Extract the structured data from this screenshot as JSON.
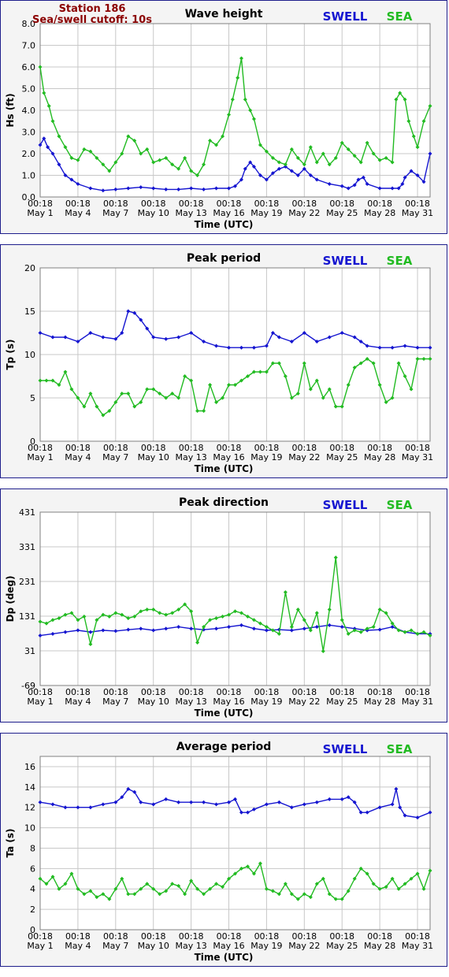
{
  "header": {
    "station": "Station 186",
    "cutoff": "Sea/swell cutoff: 10s"
  },
  "legend": {
    "swell": "SWELL",
    "sea": "SEA"
  },
  "colors": {
    "swell": "#1515d0",
    "sea": "#22bb22",
    "grid": "#c8c8c8",
    "plot_bg": "#ffffff",
    "panel_bg": "#f4f4f4"
  },
  "x_axis": {
    "label": "Time (UTC)",
    "tick_time": "00:18",
    "tick_dates": [
      "May 1",
      "May 4",
      "May 7",
      "May 10",
      "May 13",
      "May 16",
      "May 19",
      "May 22",
      "May 25",
      "May 28",
      "May 31"
    ]
  },
  "chart_data": [
    {
      "type": "line",
      "title": "Wave height",
      "ylabel": "Hs (ft)",
      "xlabel": "Time (UTC)",
      "ylim": [
        0.0,
        8.0
      ],
      "yticks": [
        "0.0",
        "1.0",
        "2.0",
        "3.0",
        "4.0",
        "5.0",
        "6.0",
        "7.0",
        "8.0"
      ],
      "x_unit": "days since May 1 00:18",
      "xlim": [
        0,
        31
      ],
      "grid": true,
      "series": [
        {
          "name": "SWELL",
          "x": [
            0,
            0.3,
            0.6,
            1,
            1.5,
            2,
            2.5,
            3,
            4,
            5,
            6,
            7,
            8,
            9,
            10,
            11,
            12,
            13,
            14,
            15,
            15.5,
            16,
            16.3,
            16.7,
            17,
            17.5,
            18,
            18.5,
            19,
            19.5,
            20,
            20.5,
            21,
            21.5,
            22,
            23,
            24,
            24.5,
            25,
            25.3,
            25.7,
            26,
            27,
            28,
            28.5,
            28.8,
            29,
            29.5,
            30,
            30.5,
            31
          ],
          "values": [
            2.4,
            2.7,
            2.3,
            2.0,
            1.5,
            1.0,
            0.8,
            0.6,
            0.4,
            0.3,
            0.35,
            0.4,
            0.45,
            0.4,
            0.35,
            0.35,
            0.4,
            0.35,
            0.4,
            0.4,
            0.5,
            0.8,
            1.3,
            1.6,
            1.4,
            1.0,
            0.8,
            1.1,
            1.3,
            1.4,
            1.2,
            1.0,
            1.3,
            1.0,
            0.8,
            0.6,
            0.5,
            0.4,
            0.55,
            0.8,
            0.9,
            0.6,
            0.4,
            0.4,
            0.4,
            0.6,
            0.9,
            1.2,
            1.0,
            0.7,
            2.0
          ]
        },
        {
          "name": "SEA",
          "x": [
            0,
            0.3,
            0.7,
            1,
            1.5,
            2,
            2.5,
            3,
            3.5,
            4,
            4.5,
            5,
            5.5,
            6,
            6.5,
            7,
            7.5,
            8,
            8.5,
            9,
            9.5,
            10,
            10.5,
            11,
            11.5,
            12,
            12.5,
            13,
            13.5,
            14,
            14.5,
            15,
            15.3,
            15.7,
            16,
            16.3,
            16.7,
            17,
            17.5,
            18,
            18.5,
            19,
            19.5,
            20,
            20.5,
            21,
            21.5,
            22,
            22.5,
            23,
            23.5,
            24,
            24.5,
            25,
            25.5,
            26,
            26.5,
            27,
            27.5,
            28,
            28.3,
            28.6,
            29,
            29.3,
            29.7,
            30,
            30.5,
            31
          ],
          "values": [
            6.0,
            4.8,
            4.2,
            3.5,
            2.8,
            2.3,
            1.8,
            1.7,
            2.2,
            2.1,
            1.8,
            1.5,
            1.2,
            1.6,
            2.0,
            2.8,
            2.6,
            2.0,
            2.2,
            1.6,
            1.7,
            1.8,
            1.5,
            1.3,
            1.8,
            1.2,
            1.0,
            1.5,
            2.6,
            2.4,
            2.8,
            3.8,
            4.5,
            5.5,
            6.4,
            4.5,
            4.0,
            3.6,
            2.4,
            2.1,
            1.8,
            1.6,
            1.5,
            2.2,
            1.8,
            1.5,
            2.3,
            1.6,
            2.0,
            1.5,
            1.8,
            2.5,
            2.2,
            1.9,
            1.6,
            2.5,
            2.0,
            1.7,
            1.8,
            1.6,
            4.5,
            4.8,
            4.5,
            3.5,
            2.8,
            2.3,
            3.5,
            4.2
          ]
        }
      ]
    },
    {
      "type": "scatter",
      "title": "Peak period",
      "ylabel": "Tp (s)",
      "xlabel": "Time (UTC)",
      "ylim": [
        0,
        20
      ],
      "yticks": [
        "0",
        "5",
        "10",
        "15",
        "20"
      ],
      "x_unit": "days since May 1 00:18",
      "xlim": [
        0,
        31
      ],
      "grid": true,
      "series": [
        {
          "name": "SWELL",
          "x": [
            0,
            1,
            2,
            3,
            4,
            5,
            6,
            6.5,
            7,
            7.5,
            8,
            8.5,
            9,
            10,
            11,
            12,
            13,
            14,
            15,
            16,
            17,
            18,
            18.5,
            19,
            20,
            21,
            22,
            23,
            24,
            25,
            25.5,
            26,
            27,
            28,
            29,
            30,
            31
          ],
          "values": [
            12.5,
            12.0,
            12.0,
            11.5,
            12.5,
            12.0,
            11.8,
            12.5,
            15.0,
            14.8,
            14.0,
            13.0,
            12.0,
            11.8,
            12.0,
            12.5,
            11.5,
            11.0,
            10.8,
            10.8,
            10.8,
            11.0,
            12.5,
            12.0,
            11.5,
            12.5,
            11.5,
            12.0,
            12.5,
            12.0,
            11.5,
            11.0,
            10.8,
            10.8,
            11.0,
            10.8,
            10.8
          ]
        },
        {
          "name": "SEA",
          "x": [
            0,
            0.5,
            1,
            1.5,
            2,
            2.5,
            3,
            3.5,
            4,
            4.5,
            5,
            5.5,
            6,
            6.5,
            7,
            7.5,
            8,
            8.5,
            9,
            9.5,
            10,
            10.5,
            11,
            11.5,
            12,
            12.5,
            13,
            13.5,
            14,
            14.5,
            15,
            15.5,
            16,
            16.5,
            17,
            17.5,
            18,
            18.5,
            19,
            19.5,
            20,
            20.5,
            21,
            21.5,
            22,
            22.5,
            23,
            23.5,
            24,
            24.5,
            25,
            25.5,
            26,
            26.5,
            27,
            27.5,
            28,
            28.5,
            29,
            29.5,
            30,
            30.5,
            31
          ],
          "values": [
            7.0,
            7.0,
            7.0,
            6.5,
            8.0,
            6.0,
            5.0,
            4.0,
            5.5,
            4.0,
            3.0,
            3.5,
            4.5,
            5.5,
            5.5,
            4.0,
            4.5,
            6.0,
            6.0,
            5.5,
            5.0,
            5.5,
            5.0,
            7.5,
            7.0,
            3.5,
            3.5,
            6.5,
            4.5,
            5.0,
            6.5,
            6.5,
            7.0,
            7.5,
            8.0,
            8.0,
            8.0,
            9.0,
            9.0,
            7.5,
            5.0,
            5.5,
            9.0,
            6.0,
            7.0,
            5.0,
            6.0,
            4.0,
            4.0,
            6.5,
            8.5,
            9.0,
            9.5,
            9.0,
            6.5,
            4.5,
            5.0,
            9.0,
            7.5,
            6.0,
            9.5,
            9.5,
            9.5
          ]
        }
      ]
    },
    {
      "type": "scatter",
      "title": "Peak direction",
      "ylabel": "Dp (deg)",
      "xlabel": "Time (UTC)",
      "ylim": [
        -69,
        431
      ],
      "yticks": [
        "-69",
        "31",
        "131",
        "231",
        "331",
        "431"
      ],
      "x_unit": "days since May 1 00:18",
      "xlim": [
        0,
        31
      ],
      "grid": true,
      "series": [
        {
          "name": "SWELL",
          "x": [
            0,
            1,
            2,
            3,
            4,
            5,
            6,
            7,
            8,
            9,
            10,
            11,
            12,
            13,
            14,
            15,
            16,
            17,
            18,
            19,
            20,
            21,
            22,
            23,
            24,
            25,
            26,
            27,
            28,
            29,
            30,
            31
          ],
          "values": [
            75,
            80,
            85,
            90,
            85,
            90,
            88,
            92,
            95,
            90,
            95,
            100,
            95,
            92,
            95,
            100,
            105,
            95,
            90,
            92,
            90,
            95,
            100,
            105,
            100,
            95,
            90,
            92,
            100,
            85,
            80,
            80
          ]
        },
        {
          "name": "SEA",
          "x": [
            0,
            0.5,
            1,
            1.5,
            2,
            2.5,
            3,
            3.5,
            4,
            4.5,
            5,
            5.5,
            6,
            6.5,
            7,
            7.5,
            8,
            8.5,
            9,
            9.5,
            10,
            10.5,
            11,
            11.5,
            12,
            12.5,
            13,
            13.5,
            14,
            14.5,
            15,
            15.5,
            16,
            16.5,
            17,
            17.5,
            18,
            18.5,
            19,
            19.5,
            20,
            20.5,
            21,
            21.5,
            22,
            22.5,
            23,
            23.5,
            24,
            24.5,
            25,
            25.5,
            26,
            26.5,
            27,
            27.5,
            28,
            28.5,
            29,
            29.5,
            30,
            30.5,
            31
          ],
          "values": [
            115,
            110,
            120,
            125,
            135,
            140,
            120,
            130,
            50,
            120,
            135,
            130,
            140,
            135,
            125,
            130,
            145,
            150,
            150,
            140,
            135,
            140,
            150,
            165,
            145,
            55,
            100,
            120,
            125,
            130,
            135,
            145,
            140,
            130,
            120,
            110,
            100,
            90,
            80,
            200,
            100,
            150,
            120,
            90,
            140,
            30,
            150,
            300,
            120,
            80,
            90,
            85,
            95,
            100,
            150,
            140,
            110,
            90,
            85,
            90,
            80,
            85,
            75
          ]
        }
      ]
    },
    {
      "type": "line",
      "title": "Average period",
      "ylabel": "Ta (s)",
      "xlabel": "Time (UTC)",
      "ylim": [
        0,
        17
      ],
      "yticks": [
        "0",
        "2",
        "4",
        "6",
        "8",
        "10",
        "12",
        "14",
        "16"
      ],
      "x_unit": "days since May 1 00:18",
      "xlim": [
        0,
        31
      ],
      "grid": true,
      "series": [
        {
          "name": "SWELL",
          "x": [
            0,
            1,
            2,
            3,
            4,
            5,
            6,
            6.5,
            7,
            7.5,
            8,
            9,
            10,
            11,
            12,
            13,
            14,
            15,
            15.5,
            16,
            16.5,
            17,
            18,
            19,
            20,
            21,
            22,
            23,
            24,
            24.5,
            25,
            25.5,
            26,
            27,
            28,
            28.3,
            28.6,
            29,
            30,
            31
          ],
          "values": [
            12.5,
            12.3,
            12.0,
            12.0,
            12.0,
            12.3,
            12.5,
            13.0,
            13.8,
            13.5,
            12.5,
            12.3,
            12.8,
            12.5,
            12.5,
            12.5,
            12.3,
            12.5,
            12.8,
            11.5,
            11.5,
            11.8,
            12.3,
            12.5,
            12.0,
            12.3,
            12.5,
            12.8,
            12.8,
            13.0,
            12.5,
            11.5,
            11.5,
            12.0,
            12.3,
            13.8,
            12.0,
            11.2,
            11.0,
            11.5
          ]
        },
        {
          "name": "SEA",
          "x": [
            0,
            0.5,
            1,
            1.5,
            2,
            2.5,
            3,
            3.5,
            4,
            4.5,
            5,
            5.5,
            6,
            6.5,
            7,
            7.5,
            8,
            8.5,
            9,
            9.5,
            10,
            10.5,
            11,
            11.5,
            12,
            12.5,
            13,
            13.5,
            14,
            14.5,
            15,
            15.5,
            16,
            16.5,
            17,
            17.5,
            18,
            18.5,
            19,
            19.5,
            20,
            20.5,
            21,
            21.5,
            22,
            22.5,
            23,
            23.5,
            24,
            24.5,
            25,
            25.5,
            26,
            26.5,
            27,
            27.5,
            28,
            28.5,
            29,
            29.5,
            30,
            30.5,
            31
          ],
          "values": [
            5.0,
            4.5,
            5.2,
            4.0,
            4.5,
            5.5,
            4.0,
            3.5,
            3.8,
            3.2,
            3.5,
            3.0,
            4.0,
            5.0,
            3.5,
            3.5,
            4.0,
            4.5,
            4.0,
            3.5,
            3.8,
            4.5,
            4.3,
            3.5,
            4.8,
            4.0,
            3.5,
            4.0,
            4.5,
            4.2,
            5.0,
            5.5,
            6.0,
            6.2,
            5.5,
            6.5,
            4.0,
            3.8,
            3.5,
            4.5,
            3.5,
            3.0,
            3.5,
            3.2,
            4.5,
            5.0,
            3.5,
            3.0,
            3.0,
            3.8,
            5.0,
            6.0,
            5.5,
            4.5,
            4.0,
            4.2,
            5.0,
            4.0,
            4.5,
            5.0,
            5.5,
            4.0,
            5.8
          ]
        }
      ]
    }
  ]
}
